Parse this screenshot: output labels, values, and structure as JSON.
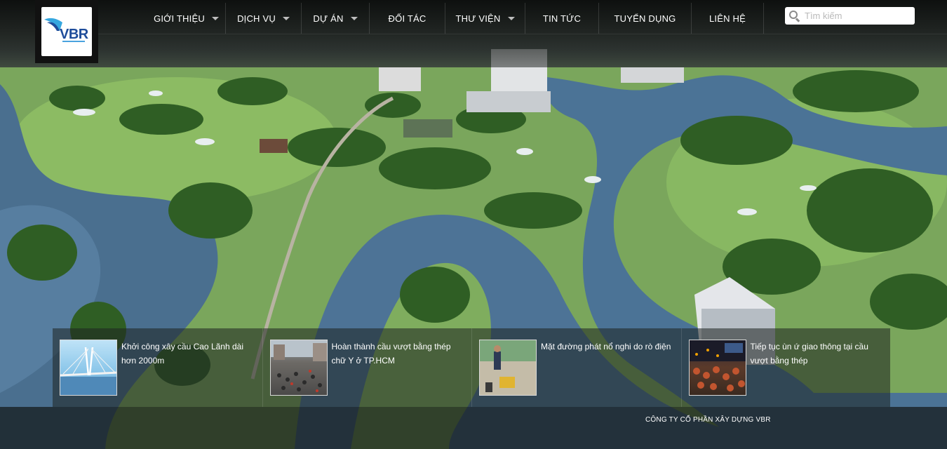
{
  "brand": {
    "logo_text": "VBR"
  },
  "nav": {
    "items": [
      {
        "label": "GIỚI THIỆU",
        "has_dropdown": true
      },
      {
        "label": "DỊCH VỤ",
        "has_dropdown": true
      },
      {
        "label": "DỰ ÁN",
        "has_dropdown": true
      },
      {
        "label": "ĐỐI TÁC",
        "has_dropdown": false
      },
      {
        "label": "THƯ VIỆN",
        "has_dropdown": true
      },
      {
        "label": "TIN TỨC",
        "has_dropdown": false
      },
      {
        "label": "TUYỂN DỤNG",
        "has_dropdown": false
      },
      {
        "label": "LIÊN HỆ",
        "has_dropdown": false
      }
    ]
  },
  "search": {
    "placeholder": "Tìm kiếm",
    "icon": "search-icon"
  },
  "news": [
    {
      "title": "Khởi công xây cầu Cao Lãnh dài hơn 2000m"
    },
    {
      "title": "Hoàn thành cầu vượt bằng thép chữ Y ở TP.HCM"
    },
    {
      "title": "Mặt đường phát nổ nghi do rò điện"
    },
    {
      "title": "Tiếp tục ùn ứ giao thông tại cầu vượt bằng thép"
    }
  ],
  "footer": {
    "company": "CÔNG TY CỔ PHẦN XÂY DỰNG VBR"
  },
  "colors": {
    "topbar": "#141716",
    "logo_blue": "#1e4c9a",
    "accent_cyan": "#4aa3df"
  }
}
